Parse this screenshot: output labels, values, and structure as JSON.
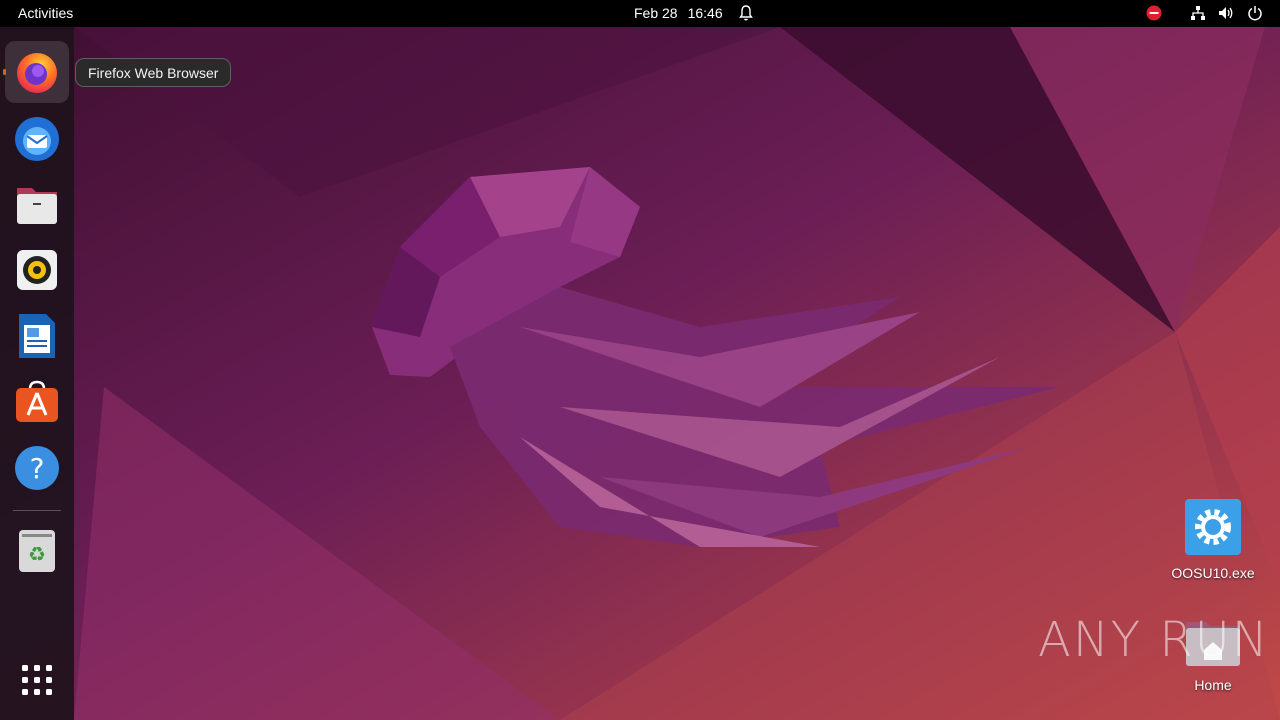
{
  "topbar": {
    "activities": "Activities",
    "date": "Feb 28",
    "time": "16:46"
  },
  "dock": {
    "items": [
      {
        "name": "Firefox Web Browser",
        "icon": "firefox-icon"
      },
      {
        "name": "Thunderbird Mail",
        "icon": "thunderbird-icon"
      },
      {
        "name": "Files",
        "icon": "files-icon"
      },
      {
        "name": "Rhythmbox",
        "icon": "rhythmbox-icon"
      },
      {
        "name": "LibreOffice Writer",
        "icon": "writer-icon"
      },
      {
        "name": "Ubuntu Software",
        "icon": "software-icon"
      },
      {
        "name": "Help",
        "icon": "help-icon"
      },
      {
        "name": "Trash",
        "icon": "trash-icon"
      },
      {
        "name": "Show Applications",
        "icon": "app-grid-icon"
      }
    ]
  },
  "tooltip": {
    "text": "Firefox Web Browser"
  },
  "desktop": {
    "icons": [
      {
        "label": "OOSU10.exe",
        "icon": "gear-icon"
      },
      {
        "label": "Home",
        "icon": "home-folder-icon"
      }
    ]
  },
  "watermark": {
    "text": "ANY RUN"
  },
  "colors": {
    "topbar": "#000000",
    "accent": "#e95420",
    "wallpaper_dark": "#4a1238",
    "wallpaper_light": "#c04a4a"
  }
}
